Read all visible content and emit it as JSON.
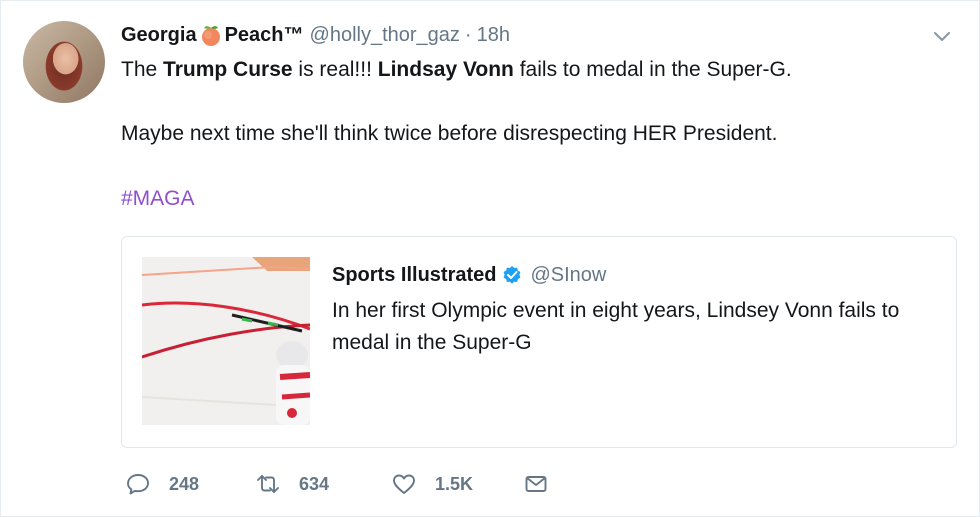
{
  "tweet": {
    "display_name_part1": "Georgia",
    "display_name_emoji": "peach-icon",
    "display_name_part2": "Peach™",
    "handle": "@holly_thor_gaz",
    "separator": "·",
    "time": "18h",
    "line1": {
      "s1": "The ",
      "b1": "Trump Curse",
      "s2": " is real!!! ",
      "b2": "Lindsay Vonn",
      "s3": " fails to medal in the Super-G."
    },
    "line2": "Maybe next time she'll think twice before disrespecting HER President.",
    "hashtag": "#MAGA",
    "hashtag_color": "#8f4fd1"
  },
  "quoted": {
    "name": "Sports Illustrated",
    "verified": true,
    "handle": "@SInow",
    "text": "In her first Olympic event in eight years, Lindsey Vonn fails to medal in the Super-G"
  },
  "actions": {
    "reply_count": "248",
    "retweet_count": "634",
    "like_count": "1.5K"
  },
  "colors": {
    "text": "#14171a",
    "muted": "#657786",
    "verified_blue": "#1da1f2",
    "border": "#e1e8ed"
  }
}
